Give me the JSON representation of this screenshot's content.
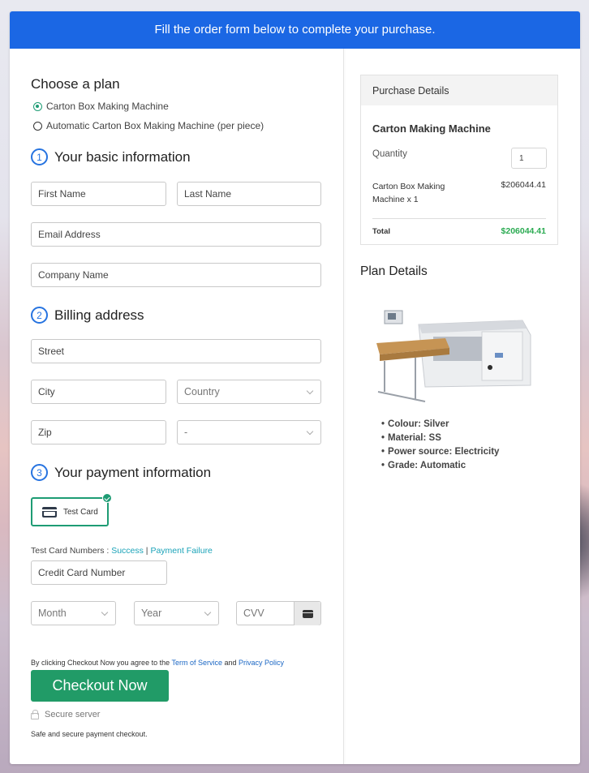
{
  "banner": {
    "text": "Fill the order form below to complete your purchase."
  },
  "plan": {
    "heading": "Choose a plan",
    "options": [
      {
        "label": "Carton Box Making Machine",
        "selected": true
      },
      {
        "label": "Automatic Carton Box Making Machine (per piece)",
        "selected": false
      }
    ]
  },
  "basic_info": {
    "step": "1",
    "heading": "Your basic information",
    "first_name": {
      "placeholder": "First Name",
      "value": ""
    },
    "last_name": {
      "placeholder": "Last Name",
      "value": ""
    },
    "email": {
      "placeholder": "Email Address",
      "value": ""
    },
    "company": {
      "placeholder": "Company Name",
      "value": ""
    }
  },
  "billing": {
    "step": "2",
    "heading": "Billing address",
    "street": {
      "placeholder": "Street",
      "value": ""
    },
    "city": {
      "placeholder": "City",
      "value": ""
    },
    "country": {
      "selected": "Country"
    },
    "zip": {
      "placeholder": "Zip",
      "value": ""
    },
    "state": {
      "selected": "-"
    }
  },
  "payment": {
    "step": "3",
    "heading": "Your payment information",
    "method_label": "Test Card",
    "test_numbers_label": "Test Card Numbers : ",
    "success_link": "Success",
    "separator": " | ",
    "failure_link": "Payment Failure",
    "card_number": {
      "placeholder": "Credit Card Number",
      "value": ""
    },
    "month": {
      "selected": "Month"
    },
    "year": {
      "selected": "Year"
    },
    "cvv": {
      "placeholder": "CVV",
      "value": ""
    },
    "agree_prefix": "By clicking Checkout Now you agree to the ",
    "terms_link": "Term of Service",
    "agree_and": " and ",
    "privacy_link": "Privacy Policy",
    "checkout_label": "Checkout Now",
    "secure_label": "Secure server",
    "safe_text": "Safe and secure payment checkout."
  },
  "purchase": {
    "heading": "Purchase Details",
    "product": "Carton Making Machine",
    "quantity_label": "Quantity",
    "quantity": "1",
    "line_item": "Carton Box Making Machine x 1",
    "line_price": "$206044.41",
    "total_label": "Total",
    "total_value": "$206044.41",
    "total_color": "#2bab52"
  },
  "plan_details": {
    "heading": "Plan Details",
    "image_alt": "Carton box making machine",
    "specs": [
      "Colour: Silver",
      "Material: SS",
      "Power source: Electricity",
      "Grade: Automatic"
    ]
  },
  "colors": {
    "brand_blue": "#1b67e4",
    "accent_green": "#219b67",
    "step_blue": "#2673e0"
  }
}
